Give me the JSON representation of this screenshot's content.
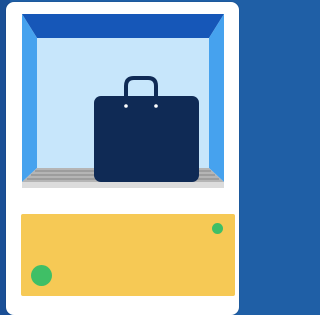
{
  "scene": {
    "icon": "briefcase-icon",
    "colors": {
      "background": "#1f5fa6",
      "card": "#ffffff",
      "frame_top": "#1657b8",
      "frame_side": "#46a2ee",
      "inner_light": "#c7e6fb",
      "briefcase": "#0f2a55",
      "conveyor": "#b5b5b5",
      "panel": "#f6c955",
      "dot": "#3fbf66"
    }
  }
}
